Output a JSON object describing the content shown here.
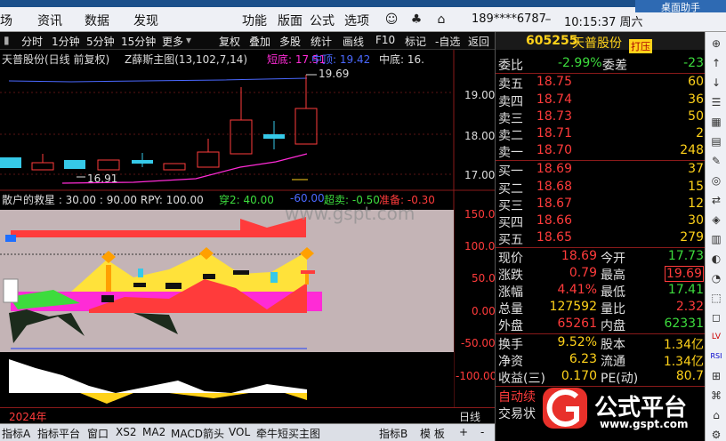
{
  "menubar": {
    "items": [
      "场",
      "资讯",
      "数据",
      "发现",
      "功能",
      "版面",
      "公式",
      "选项"
    ],
    "account": "189****6787",
    "time": "10:15:37 周六",
    "corner_text": "桌面助手"
  },
  "toolbar": {
    "items": [
      "分时",
      "1分钟",
      "5分钟",
      "15分钟",
      "更多",
      "复权",
      "叠加",
      "多股",
      "统计",
      "画线",
      "F10",
      "标记",
      "-自选",
      "返回"
    ]
  },
  "chart": {
    "title": "天普股份(日线 前复权)",
    "indicator": "Z薛斯主图(13,102,7,14)",
    "short_bottom": "短底: 17.51",
    "mid_top": "中顶: 19.42",
    "mid_bottom": "中底: 16.",
    "high_mark": "19.69",
    "low_mark": "16.91",
    "price_axis": [
      "19.00",
      "18.00",
      "17.00"
    ],
    "sub_title": "散户的救星 : 30.00 : 90.00 RPY: 100.00",
    "sub_c2": "穿2: 40.00",
    "sub_c3": "-60.00",
    "sub_c4": "超卖: -0.50",
    "sub_c5": "准备: -0.30",
    "sub_axis": [
      "150.00",
      "100.00",
      "50.00",
      "0.00",
      "-50.00",
      "-100.00"
    ],
    "watermark": "www.gspt.com",
    "year": "2024年",
    "period": "日线"
  },
  "quote": {
    "code": "605255",
    "name": "天普股份",
    "tag": "打压",
    "webi_label": "委比",
    "webi": "-2.99%",
    "weicha_label": "委差",
    "weicha": "-23",
    "asks": [
      {
        "label": "卖五",
        "price": "18.75",
        "vol": "60"
      },
      {
        "label": "卖四",
        "price": "18.74",
        "vol": "36"
      },
      {
        "label": "卖三",
        "price": "18.73",
        "vol": "50"
      },
      {
        "label": "卖二",
        "price": "18.71",
        "vol": "2"
      },
      {
        "label": "卖一",
        "price": "18.70",
        "vol": "248"
      }
    ],
    "bids": [
      {
        "label": "买一",
        "price": "18.69",
        "vol": "37"
      },
      {
        "label": "买二",
        "price": "18.68",
        "vol": "15"
      },
      {
        "label": "买三",
        "price": "18.67",
        "vol": "12"
      },
      {
        "label": "买四",
        "price": "18.66",
        "vol": "30"
      },
      {
        "label": "买五",
        "price": "18.65",
        "vol": "279"
      }
    ],
    "stats": [
      {
        "l1": "现价",
        "v1": "18.69",
        "l2": "今开",
        "v2": "17.73"
      },
      {
        "l1": "涨跌",
        "v1": "0.79",
        "l2": "最高",
        "v2": "19.69"
      },
      {
        "l1": "涨幅",
        "v1": "4.41%",
        "l2": "最低",
        "v2": "17.41"
      },
      {
        "l1": "总量",
        "v1": "127592",
        "l2": "量比",
        "v2": "2.32"
      },
      {
        "l1": "外盘",
        "v1": "65261",
        "l2": "内盘",
        "v2": "62331"
      }
    ],
    "stats2": [
      {
        "l1": "换手",
        "v1": "9.52%",
        "l2": "股本",
        "v2": "1.34亿"
      },
      {
        "l1": "净资",
        "v1": "6.23",
        "l2": "流通",
        "v2": "1.34亿"
      },
      {
        "l1": "收益(三)",
        "v1": "0.170",
        "l2": "PE(动)",
        "v2": "80.7"
      }
    ],
    "extra1": "自动续",
    "extra2": "交易状"
  },
  "tabs": [
    "指标A",
    "指标平台",
    "窗口",
    "XS2",
    "MA2",
    "MACD箭头",
    "VOL",
    "牵牛短买主图",
    "指标B",
    "模 板"
  ],
  "logo": {
    "brand": "公式平台",
    "url": "www.gspt.com"
  },
  "iconbar": [
    "⊕",
    "↑",
    "↓",
    "☰",
    "▦",
    "▤",
    "✎",
    "◎",
    "⇄",
    "◈",
    "▥",
    "◐",
    "◔",
    "⬚",
    "◻",
    "LV",
    "RSI",
    "⊞",
    "⌘",
    "⌂",
    "⚙",
    "A"
  ],
  "colors": {
    "red": "#ff3b3b",
    "green": "#3ddc3d",
    "yellow": "#ffd21a",
    "cyan": "#36c9e8",
    "magenta": "#ff2bd6"
  }
}
